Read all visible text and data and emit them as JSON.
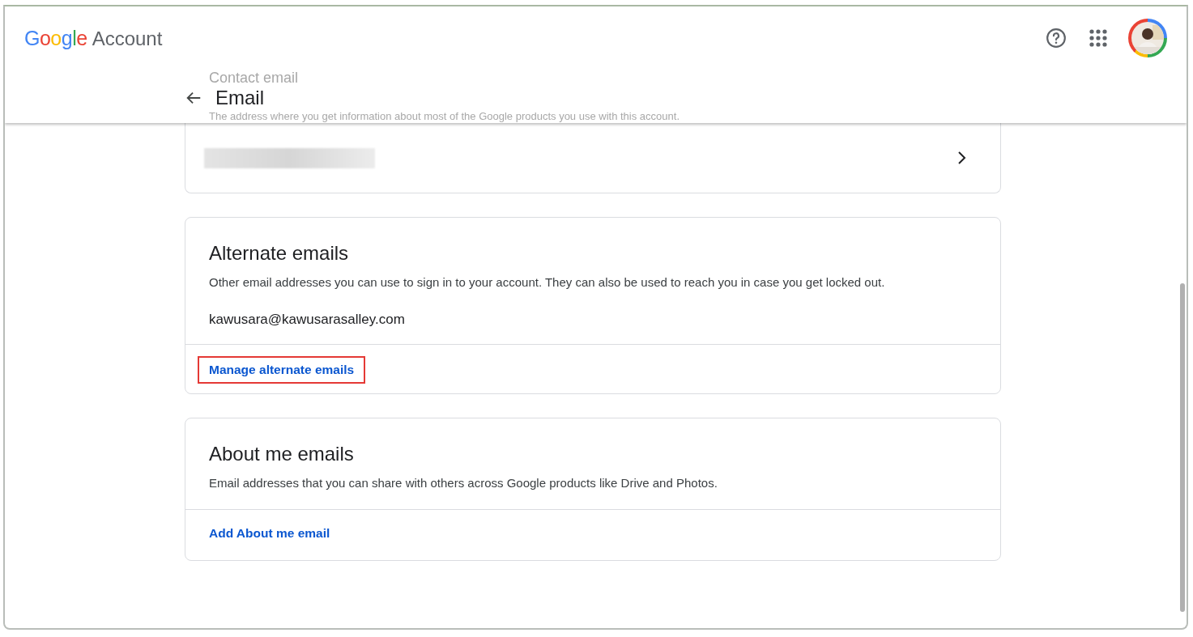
{
  "header": {
    "logo": "Google",
    "product": "Account"
  },
  "subheader": {
    "title": "Email",
    "behind_title": "Contact email",
    "behind_text": "The address where you get information about most of the Google products you use with this account."
  },
  "contact_card": {
    "value_redacted": true
  },
  "alternate_card": {
    "title": "Alternate emails",
    "description": "Other email addresses you can use to sign in to your account. They can also be used to reach you in case you get locked out.",
    "emails": [
      "kawusara@kawusarasalley.com"
    ],
    "action": "Manage alternate emails",
    "highlighted": true
  },
  "about_card": {
    "title": "About me emails",
    "description": "Email addresses that you can share with others across Google products like Drive and Photos.",
    "action": "Add About me email"
  }
}
